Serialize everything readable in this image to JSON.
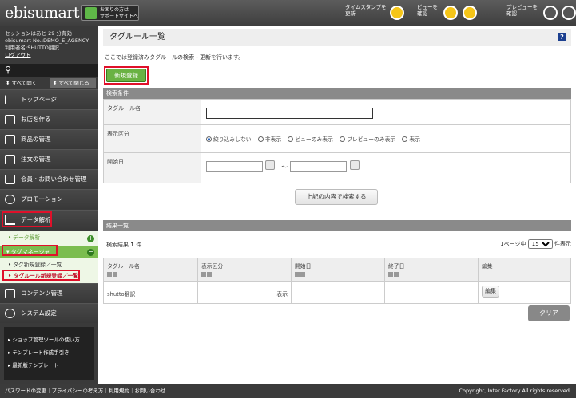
{
  "header": {
    "logo": "ebisumart",
    "support_line1": "お困りの方は",
    "support_line2": "サポートサイトへ",
    "timestamp_line1": "タイムスタンプを",
    "timestamp_line2": "更新",
    "view_line1": "ビューを",
    "view_line2": "確認",
    "preview_line1": "プレビューを",
    "preview_line2": "確認"
  },
  "session": {
    "line1": "セッションはあと 29 分有効",
    "line2": "ebisumart No.:DEMO_E_AGENCY",
    "line3": "利用者名:SHUTTO翻訳",
    "logout": "ログアウト"
  },
  "sidebar": {
    "expand_all": "すべて開く",
    "collapse_all": "すべて閉じる",
    "items": [
      {
        "label": "トップページ",
        "icon": "flag-icon"
      },
      {
        "label": "お店を作る",
        "icon": "store-icon"
      },
      {
        "label": "商品の管理",
        "icon": "box-icon"
      },
      {
        "label": "注文の管理",
        "icon": "order-icon"
      },
      {
        "label": "会員・お問い合わせ管理",
        "icon": "member-icon"
      },
      {
        "label": "プロモーション",
        "icon": "promotion-icon"
      },
      {
        "label": "データ解析",
        "icon": "chart-icon"
      }
    ],
    "data_sub1": "データ解析",
    "tag_manager": "タグマネージャ",
    "tag_sub1": "タグ新規登録／一覧",
    "tag_sub2": "タグルール新規登録／一覧",
    "items2": [
      {
        "label": "コンテンツ管理",
        "icon": "content-icon"
      },
      {
        "label": "システム設定",
        "icon": "settings-icon"
      }
    ],
    "bottom_links": [
      "ショップ管理ツールの使い方",
      "テンプレート作成手引き",
      "最新版テンプレート"
    ]
  },
  "footer": {
    "links": "パスワードの変更｜プライバシーの考え方｜利用規約｜お問い合わせ",
    "copyright": "Copyright, Inter Factory All rights reserved."
  },
  "page": {
    "title": "タグルール一覧",
    "help": "?",
    "description": "ここでは登録済みタグルールの検索・更新を行います。",
    "new_button": "新規登録"
  },
  "search": {
    "header": "検索条件",
    "rule_name_label": "タグルール名",
    "rule_name_value": "",
    "display_label": "表示区分",
    "options": [
      "絞り込みしない",
      "非表示",
      "ビューのみ表示",
      "プレビューのみ表示",
      "表示"
    ],
    "selected": "絞り込みしない",
    "start_label": "開始日",
    "tilde": "～",
    "start_from": "",
    "start_to": "",
    "search_button": "上記の内容で検索する"
  },
  "results": {
    "header": "結果一覧",
    "count_label": "検索結果",
    "count": "1",
    "count_unit": "件",
    "per_page_prefix": "1ページ中",
    "per_page": "15",
    "per_page_suffix": "件表示",
    "columns": [
      "タグルール名",
      "表示区分",
      "開始日",
      "終了日",
      "編集"
    ],
    "rows": [
      {
        "name": "shutto翻訳",
        "display": "表示",
        "start": "",
        "end": "",
        "edit": "編集"
      }
    ],
    "clear_button": "クリア"
  },
  "colors": {
    "accent_green": "#6ab243",
    "highlight_red": "#e0102a",
    "sidebar_bg": "#3a3a3a"
  }
}
